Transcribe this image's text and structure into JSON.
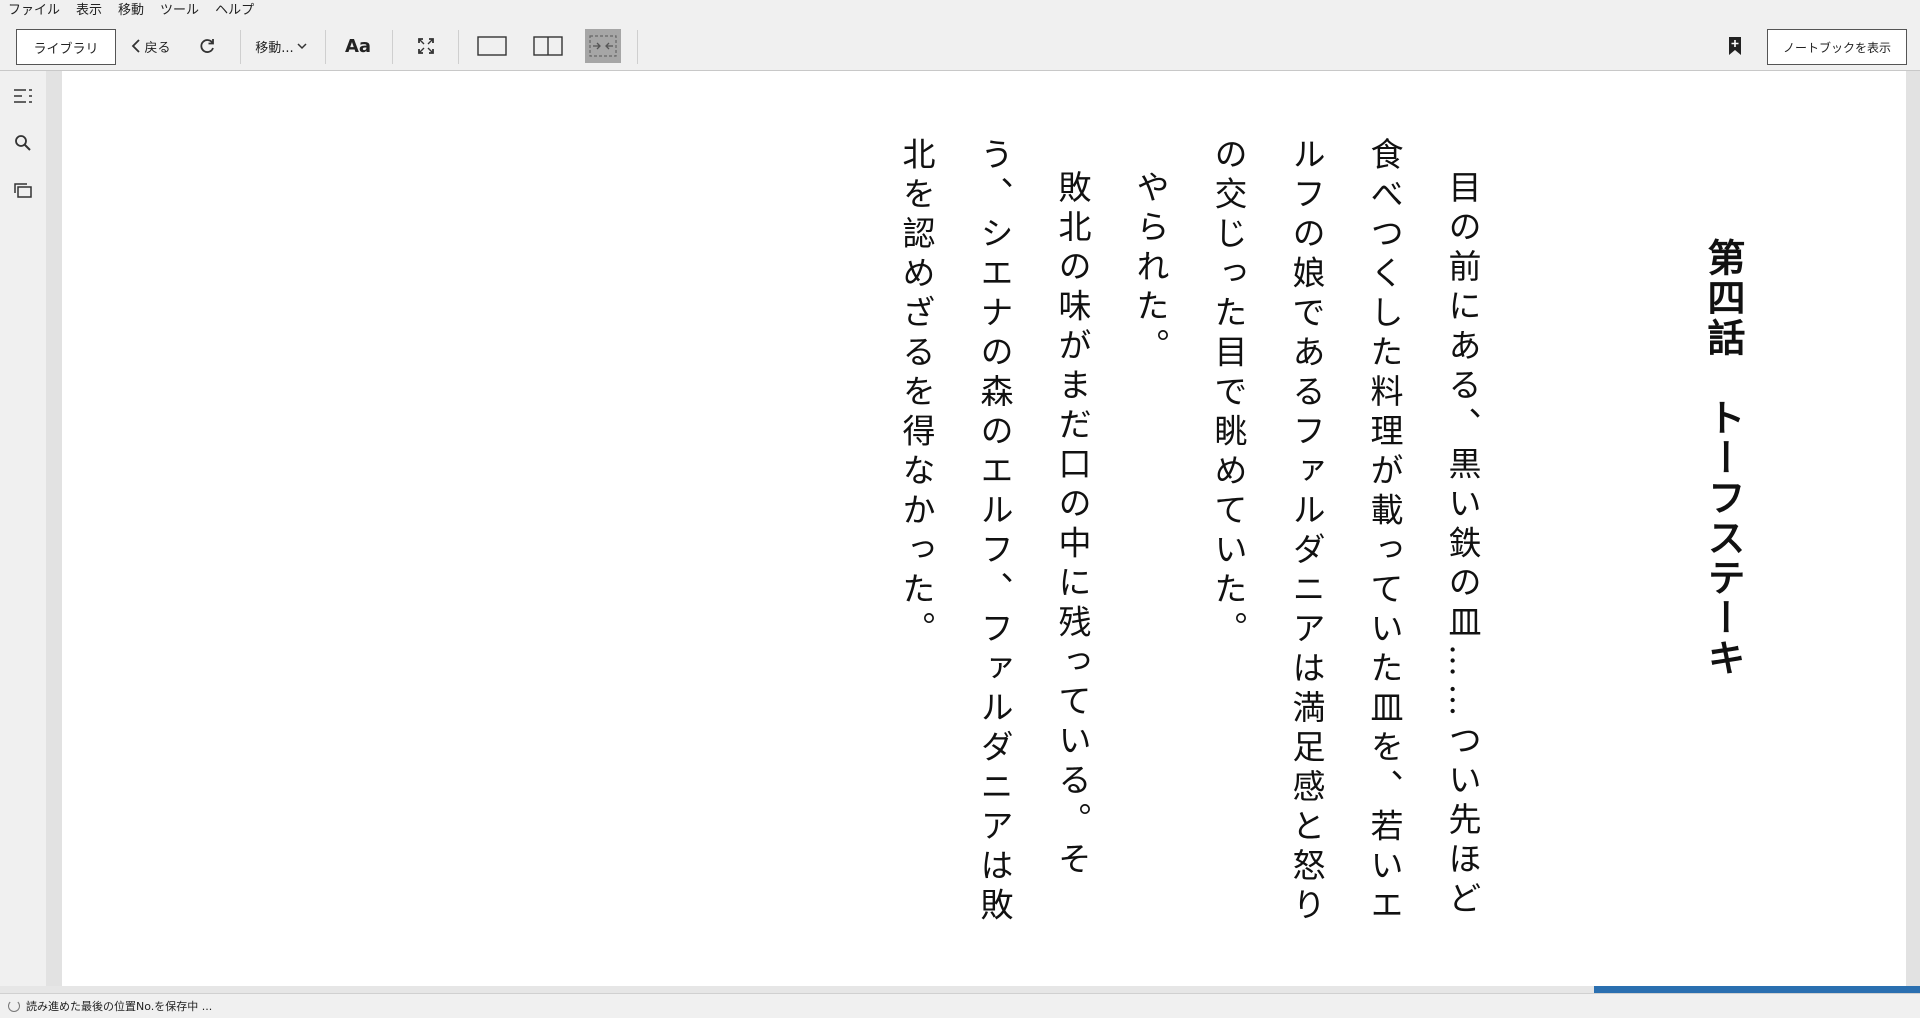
{
  "menu": [
    "ファイル",
    "表示",
    "移動",
    "ツール",
    "ヘルプ"
  ],
  "toolbar": {
    "library": "ライブラリ",
    "back": "戻る",
    "goto": "移動...",
    "font": "Aa",
    "notebook": "ノートブックを表示"
  },
  "book": {
    "chapter_title": "第四話　トーフステーキ",
    "paragraphs": [
      "目の前にある、黒い鉄の皿……つい先ほど食べつくした料理が載っていた皿を、若いエルフの娘であるファルダニアは満足感と怒りの交じった目で眺めていた。",
      "",
      "やられた。",
      "",
      "敗北の味がまだ口の中に残っている。そう、シエナの森のエルフ、ファルダニアは敗北を認めざるを得なかった。"
    ]
  },
  "status": {
    "text": "読み進めた最後の位置No.を保存中 ...",
    "progress_fraction": 0.17
  },
  "colors": {
    "progress": "#2a6fb0",
    "page_bg": "#ffffff",
    "chrome_bg": "#f0f0f0"
  }
}
